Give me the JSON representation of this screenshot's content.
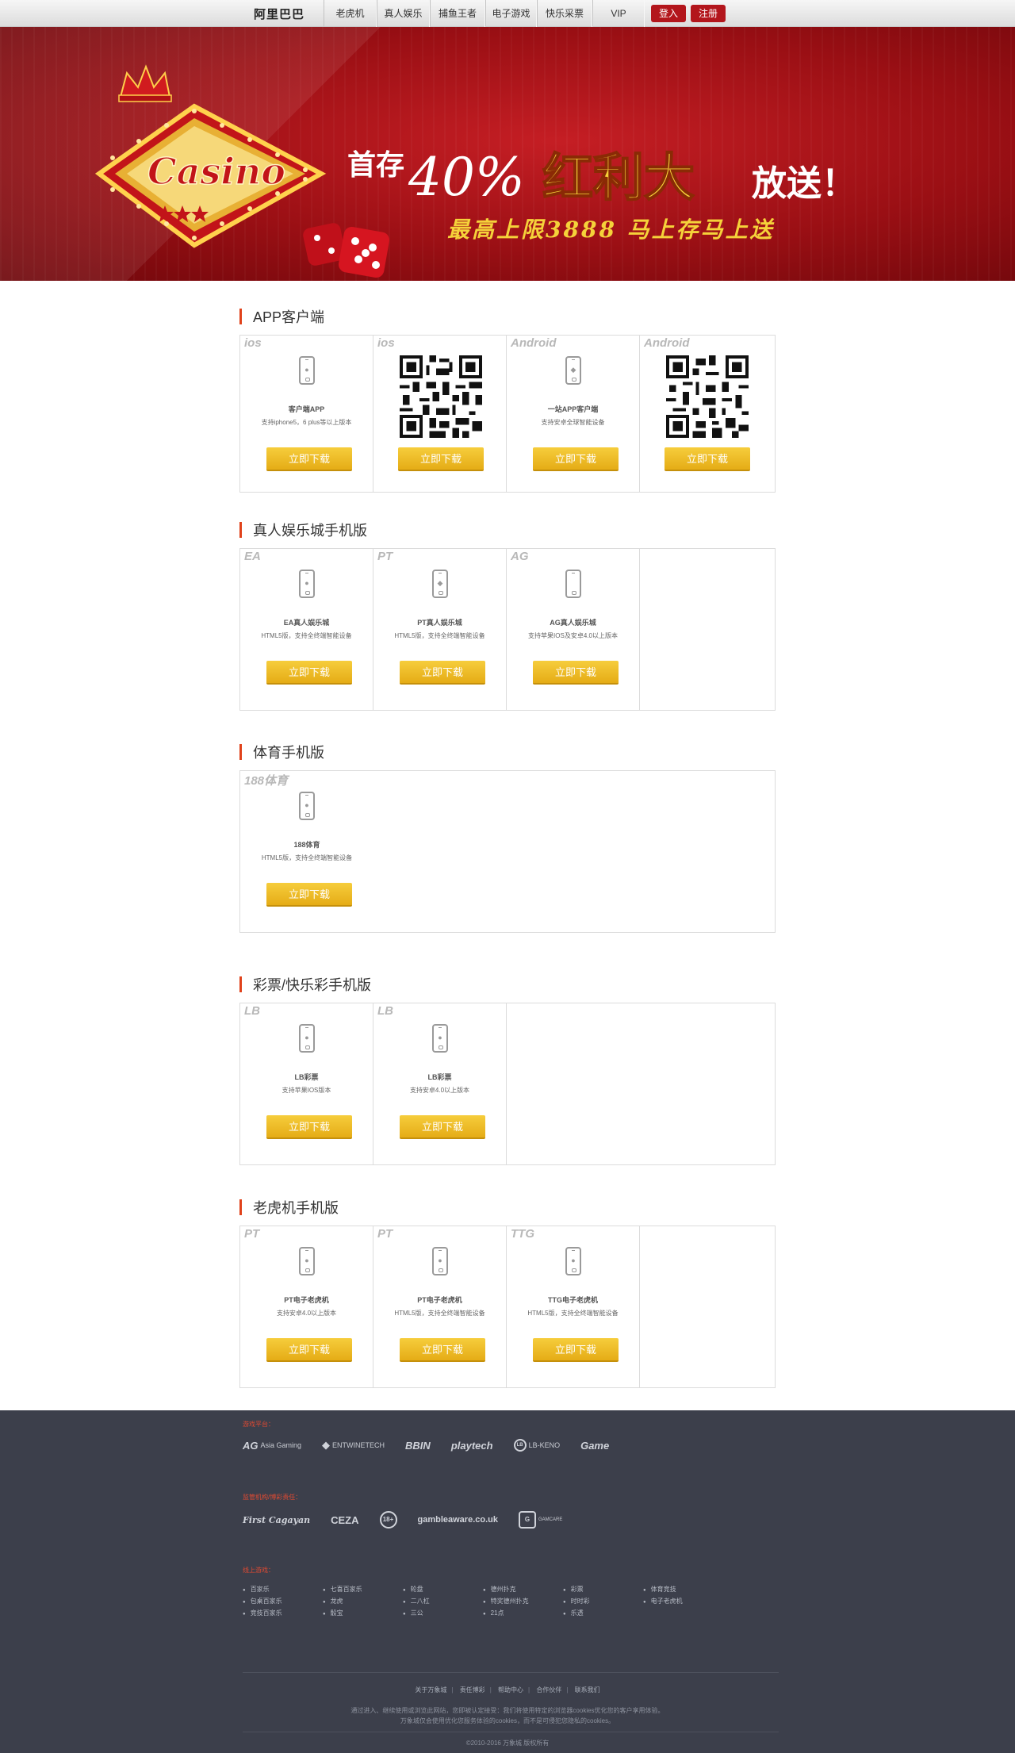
{
  "nav": {
    "logo": "阿里巴巴",
    "links": [
      "老虎机",
      "真人娱乐",
      "捕鱼王者",
      "电子游戏",
      "快乐采票",
      "VIP"
    ],
    "login": "登入",
    "register": "注册"
  },
  "banner": {
    "sign": "Casino",
    "headline_prefix": "首存",
    "headline_percent": "40%",
    "headline_bonus": "红利大",
    "headline_suffix": "放送！",
    "subline": "最高上限3888 马上存马上送",
    "colors": {
      "red": "#b3161c",
      "gold": "#f5d23a"
    }
  },
  "download_label": "立即下载",
  "sections": [
    {
      "title": "APP客户端",
      "cards": [
        {
          "tag": "ios",
          "name": "客户端APP",
          "desc": "支持iphone5，6 plus等以上版本",
          "icon": "apple-phone-icon"
        },
        {
          "tag": "ios",
          "qr": true,
          "icon": "qr-code-icon"
        },
        {
          "tag": "Android",
          "name": "一站APP客户端",
          "desc": "支持安卓全球智能设备",
          "icon": "android-phone-icon"
        },
        {
          "tag": "Android",
          "qr": true,
          "icon": "qr-code-icon"
        }
      ]
    },
    {
      "title": "真人娱乐城手机版",
      "cards": [
        {
          "tag": "EA",
          "name": "EA真人娱乐城",
          "desc": "HTML5版，支持全终端智能设备",
          "icon": "apple-phone-icon"
        },
        {
          "tag": "PT",
          "name": "PT真人娱乐城",
          "desc": "HTML5版，支持全终端智能设备",
          "icon": "android-phone-icon"
        },
        {
          "tag": "AG",
          "name": "AG真人娱乐城",
          "desc": "支持苹果IOS及安卓4.0以上版本",
          "icon": "phone-icon"
        }
      ]
    },
    {
      "title": "体育手机版",
      "cards": [
        {
          "tag": "188体育",
          "name": "188体育",
          "desc": "HTML5版，支持全终端智能设备",
          "icon": "apple-phone-icon"
        }
      ]
    },
    {
      "title": "彩票/快乐彩手机版",
      "cards": [
        {
          "tag": "LB",
          "name": "LB彩票",
          "desc": "支持苹果IOS版本",
          "icon": "apple-phone-icon"
        },
        {
          "tag": "LB",
          "name": "LB彩票",
          "desc": "支持安卓4.0以上版本",
          "icon": "apple-phone-icon"
        }
      ]
    },
    {
      "title": "老虎机手机版",
      "cards": [
        {
          "tag": "PT",
          "name": "PT电子老虎机",
          "desc": "支持安卓4.0以上版本",
          "icon": "apple-phone-icon"
        },
        {
          "tag": "PT",
          "name": "PT电子老虎机",
          "desc": "HTML5版，支持全终端智能设备",
          "icon": "apple-phone-icon"
        },
        {
          "tag": "TTG",
          "name": "TTG电子老虎机",
          "desc": "HTML5版，支持全终端智能设备",
          "icon": "apple-phone-icon"
        }
      ]
    }
  ],
  "footer": {
    "platforms_label": "游戏平台：",
    "platforms": [
      {
        "mark": "AG",
        "text": "Asia Gaming"
      },
      {
        "mark": "",
        "text": "ENTWINETECH"
      },
      {
        "mark": "BBIN",
        "text": ""
      },
      {
        "mark": "playtech",
        "text": ""
      },
      {
        "mark": "LB-KENO",
        "text": ""
      },
      {
        "mark": "Game",
        "text": ""
      }
    ],
    "licenses_label": "监管机构/博彩责任：",
    "licenses": [
      {
        "mark": "First Cagayan",
        "text": ""
      },
      {
        "mark": "CEZA",
        "text": ""
      },
      {
        "mark": "18+",
        "text": ""
      },
      {
        "mark": "gambleaware.co.uk",
        "text": ""
      },
      {
        "mark": "G",
        "text": "GAMCARE"
      }
    ],
    "games_label": "线上游戏：",
    "games": [
      "百家乐",
      "七喜百家乐",
      "轮盘",
      "德州扑克",
      "彩票",
      "体育竞技",
      "包桌百家乐",
      "龙虎",
      "二八杠",
      "特奖德州扑克",
      "时时彩",
      "电子老虎机",
      "竞技百家乐",
      "骰宝",
      "三公",
      "21点",
      "乐透",
      ""
    ],
    "nav": [
      "关于万象城",
      "责任博彩",
      "帮助中心",
      "合作伙伴",
      "联系我们"
    ],
    "notice1": "通过进入、继续使用或浏览此网站，您即被认定接受：我们将使用特定的浏览器cookies优化您的客户享用体验。",
    "notice2": "万象城仅会使用优化您服务体验的cookies，而不是可侵犯您隐私的cookies。",
    "copyright": "©2010-2016 万象城 版权所有"
  }
}
